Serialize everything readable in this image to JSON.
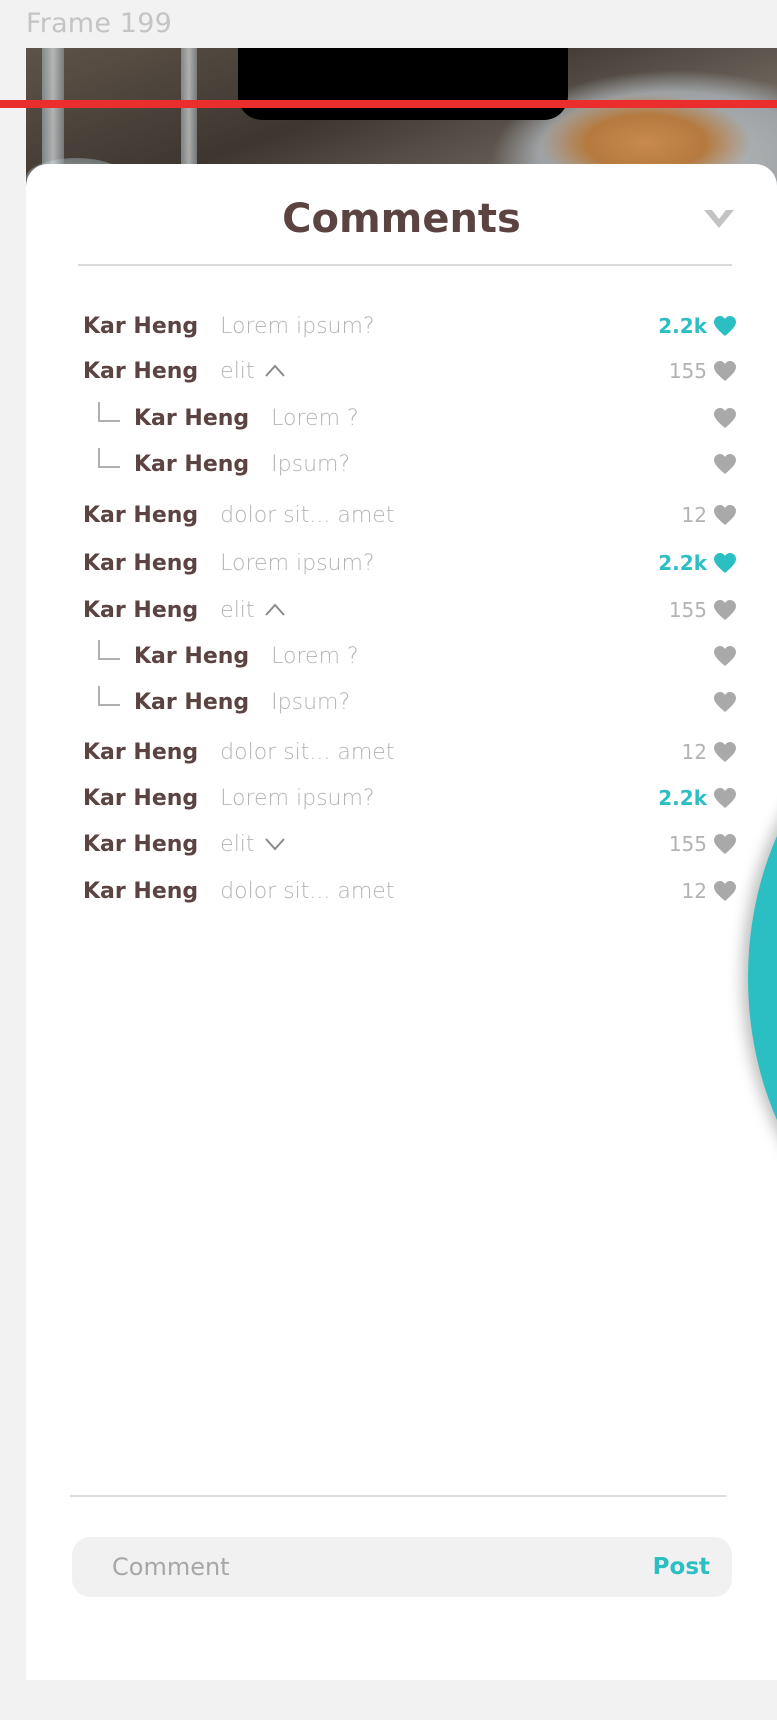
{
  "frame_label": "Frame 199",
  "sheet": {
    "title": "Comments",
    "collapse_icon": "chevron-down-icon"
  },
  "colors": {
    "accent": "#2bbfc4",
    "name": "#5a4340",
    "muted": "#b3b3b3",
    "alert_line": "#ec2d2d"
  },
  "comments": [
    {
      "name": "Kar Heng",
      "text": "Lorem ipsum?",
      "likes": "2.2k",
      "liked": true,
      "reply": false,
      "toggle": ""
    },
    {
      "name": "Kar Heng",
      "text": "elit",
      "likes": "155",
      "liked": false,
      "reply": false,
      "toggle": "up"
    },
    {
      "name": "Kar Heng",
      "text": "Lorem ?",
      "likes": "",
      "liked": false,
      "reply": true,
      "toggle": ""
    },
    {
      "name": "Kar Heng",
      "text": "Ipsum?",
      "likes": "",
      "liked": false,
      "reply": true,
      "toggle": ""
    },
    {
      "name": "Kar Heng",
      "text": "dolor sit... amet",
      "likes": "12",
      "liked": false,
      "reply": false,
      "toggle": ""
    },
    {
      "name": "Kar Heng",
      "text": "Lorem ipsum?",
      "likes": "2.2k",
      "liked": true,
      "reply": false,
      "toggle": ""
    },
    {
      "name": "Kar Heng",
      "text": "elit",
      "likes": "155",
      "liked": false,
      "reply": false,
      "toggle": "up"
    },
    {
      "name": "Kar Heng",
      "text": "Lorem ?",
      "likes": "",
      "liked": false,
      "reply": true,
      "toggle": ""
    },
    {
      "name": "Kar Heng",
      "text": "Ipsum?",
      "likes": "",
      "liked": false,
      "reply": true,
      "toggle": ""
    },
    {
      "name": "Kar Heng",
      "text": "dolor sit... amet",
      "likes": "12",
      "liked": false,
      "reply": false,
      "toggle": ""
    },
    {
      "name": "Kar Heng",
      "text": "Lorem ipsum?",
      "likes": "2.2k",
      "liked": false,
      "likes_teal": true,
      "reply": false,
      "toggle": ""
    },
    {
      "name": "Kar Heng",
      "text": "elit",
      "likes": "155",
      "liked": false,
      "reply": false,
      "toggle": "down"
    },
    {
      "name": "Kar Heng",
      "text": "dolor sit... amet",
      "likes": "12",
      "liked": false,
      "reply": false,
      "toggle": ""
    }
  ],
  "composer": {
    "placeholder": "Comment",
    "post_label": "Post"
  }
}
